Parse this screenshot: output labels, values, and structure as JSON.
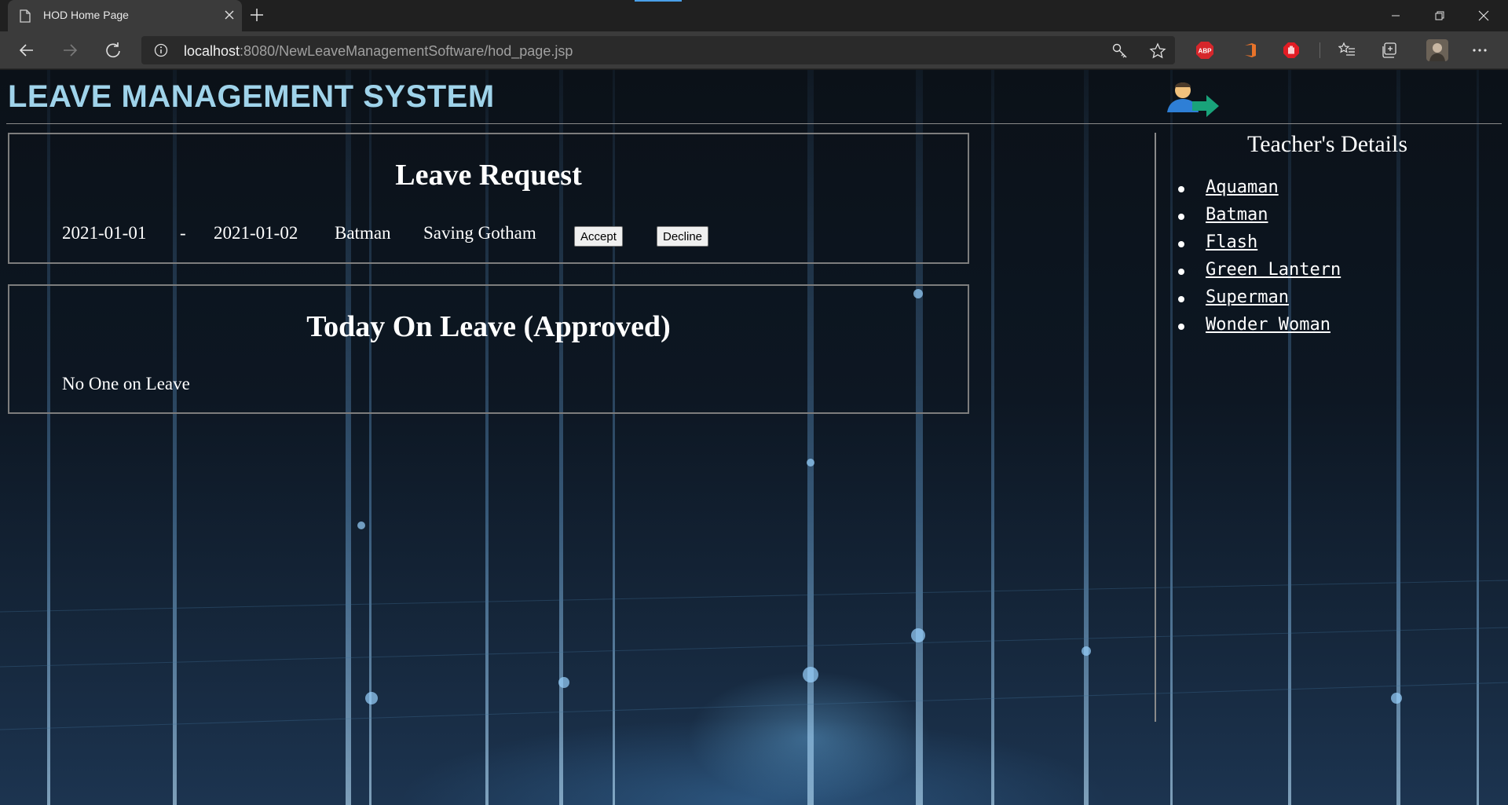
{
  "browser": {
    "tab_title": "HOD Home Page",
    "url_host": "localhost",
    "url_rest": ":8080/NewLeaveManagementSoftware/hod_page.jsp",
    "extensions": [
      "key-icon",
      "star-icon",
      "adblock-plus-icon",
      "office-icon",
      "stop-hand-icon",
      "favorites-icon",
      "collections-icon",
      "profile-avatar",
      "more-icon"
    ]
  },
  "page": {
    "title": "LEAVE MANAGEMENT SYSTEM",
    "leave_request": {
      "heading": "Leave Request",
      "request": {
        "from_date": "2021-01-01",
        "separator": "-",
        "to_date": "2021-01-02",
        "teacher": "Batman",
        "reason": "Saving Gotham",
        "accept_label": "Accept",
        "decline_label": "Decline"
      }
    },
    "today_on_leave": {
      "heading": "Today On Leave (Approved)",
      "empty_text": "No One on Leave"
    },
    "teachers": {
      "heading": "Teacher's Details",
      "items": [
        "Aquaman",
        "Batman",
        "Flash",
        "Green Lantern",
        "Superman",
        "Wonder Woman"
      ]
    }
  },
  "colors": {
    "title": "#9fd3ea",
    "chrome": "#3b3b3b",
    "tabbar": "#202020"
  }
}
